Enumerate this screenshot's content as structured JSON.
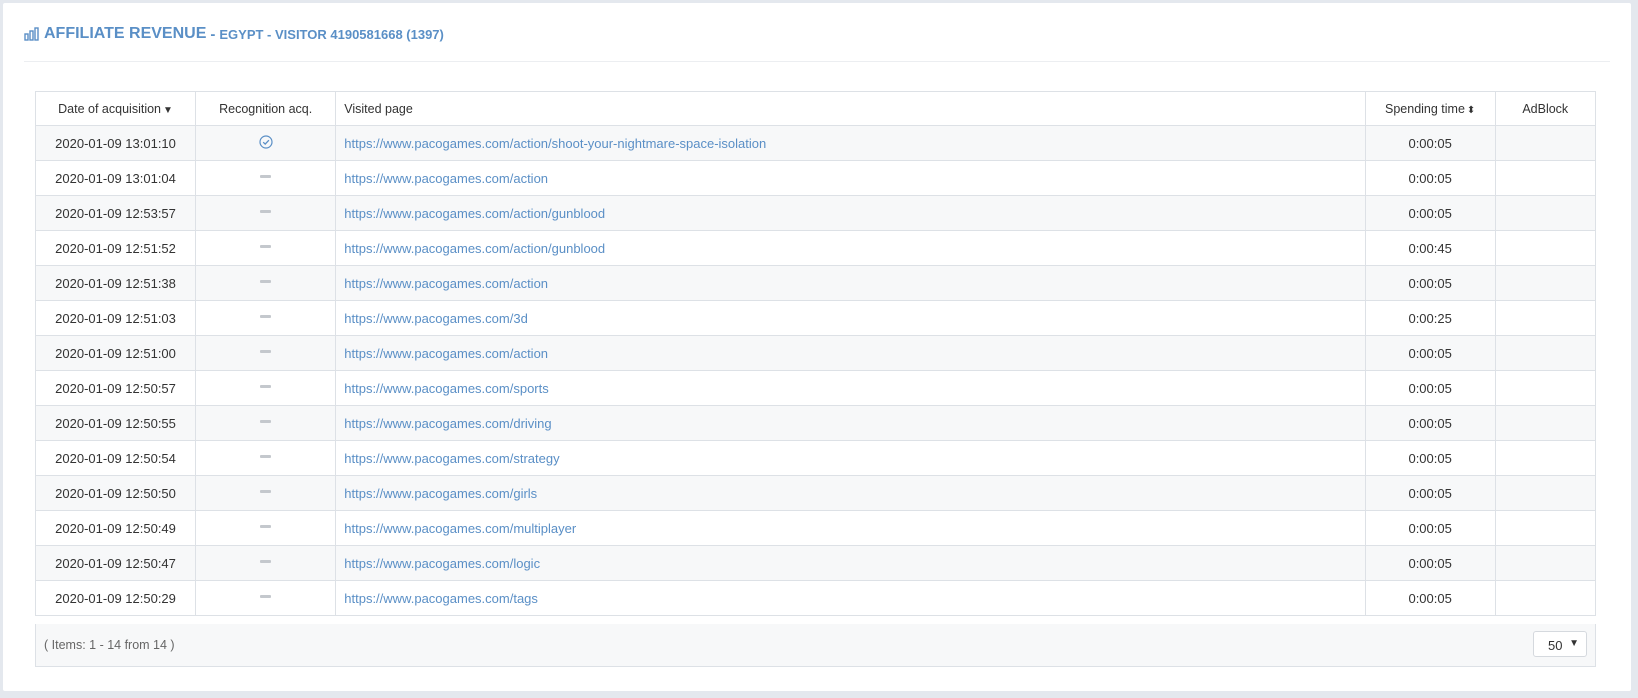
{
  "header": {
    "title": "AFFILIATE REVENUE",
    "separator": "-",
    "subtitle": "EGYPT - VISITOR 4190581668 (1397)"
  },
  "table": {
    "columns": {
      "date": "Date of acquisition",
      "recognition": "Recognition acq.",
      "visited_page": "Visited page",
      "spending_time": "Spending time",
      "adblock": "AdBlock"
    },
    "rows": [
      {
        "date": "2020-01-09 13:01:10",
        "recognition": "check-icon",
        "url": "https://www.pacogames.com/action/shoot-your-nightmare-space-isolation",
        "time": "0:00:05",
        "adblock": ""
      },
      {
        "date": "2020-01-09 13:01:04",
        "recognition": "dash-icon",
        "url": "https://www.pacogames.com/action",
        "time": "0:00:05",
        "adblock": ""
      },
      {
        "date": "2020-01-09 12:53:57",
        "recognition": "dash-icon",
        "url": "https://www.pacogames.com/action/gunblood",
        "time": "0:00:05",
        "adblock": ""
      },
      {
        "date": "2020-01-09 12:51:52",
        "recognition": "dash-icon",
        "url": "https://www.pacogames.com/action/gunblood",
        "time": "0:00:45",
        "adblock": ""
      },
      {
        "date": "2020-01-09 12:51:38",
        "recognition": "dash-icon",
        "url": "https://www.pacogames.com/action",
        "time": "0:00:05",
        "adblock": ""
      },
      {
        "date": "2020-01-09 12:51:03",
        "recognition": "dash-icon",
        "url": "https://www.pacogames.com/3d",
        "time": "0:00:25",
        "adblock": ""
      },
      {
        "date": "2020-01-09 12:51:00",
        "recognition": "dash-icon",
        "url": "https://www.pacogames.com/action",
        "time": "0:00:05",
        "adblock": ""
      },
      {
        "date": "2020-01-09 12:50:57",
        "recognition": "dash-icon",
        "url": "https://www.pacogames.com/sports",
        "time": "0:00:05",
        "adblock": ""
      },
      {
        "date": "2020-01-09 12:50:55",
        "recognition": "dash-icon",
        "url": "https://www.pacogames.com/driving",
        "time": "0:00:05",
        "adblock": ""
      },
      {
        "date": "2020-01-09 12:50:54",
        "recognition": "dash-icon",
        "url": "https://www.pacogames.com/strategy",
        "time": "0:00:05",
        "adblock": ""
      },
      {
        "date": "2020-01-09 12:50:50",
        "recognition": "dash-icon",
        "url": "https://www.pacogames.com/girls",
        "time": "0:00:05",
        "adblock": ""
      },
      {
        "date": "2020-01-09 12:50:49",
        "recognition": "dash-icon",
        "url": "https://www.pacogames.com/multiplayer",
        "time": "0:00:05",
        "adblock": ""
      },
      {
        "date": "2020-01-09 12:50:47",
        "recognition": "dash-icon",
        "url": "https://www.pacogames.com/logic",
        "time": "0:00:05",
        "adblock": ""
      },
      {
        "date": "2020-01-09 12:50:29",
        "recognition": "dash-icon",
        "url": "https://www.pacogames.com/tags",
        "time": "0:00:05",
        "adblock": ""
      }
    ]
  },
  "footer": {
    "items_info": "( Items: 1 - 14 from 14 )",
    "page_size": "50"
  },
  "colors": {
    "accent": "#5a8fc6",
    "row_alt": "#f7f8f9",
    "border": "#dde1e6",
    "background": "#e4e8ee"
  }
}
